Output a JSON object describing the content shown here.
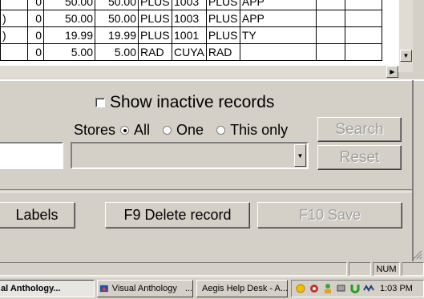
{
  "grid": {
    "rows": [
      [
        "",
        "0",
        "50.00",
        "50.00",
        "PLUS",
        "1003",
        "PLUS",
        "APP"
      ],
      [
        ")",
        "0",
        "50.00",
        "50.00",
        "PLUS",
        "1003",
        "PLUS",
        "APP"
      ],
      [
        ")",
        "0",
        "19.99",
        "19.99",
        "PLUS",
        "1001",
        "PLUS",
        "TY"
      ],
      [
        "",
        "0",
        "5.00",
        "5.00",
        "RAD",
        "CUYA",
        "RAD",
        ""
      ]
    ]
  },
  "filters": {
    "show_inactive_label": "Show inactive records",
    "stores_label": "Stores",
    "radio_all": "All",
    "radio_one": "One",
    "radio_this_only": "This only",
    "search_label": "Search",
    "reset_label": "Reset"
  },
  "actions": {
    "labels_label": "Labels",
    "delete_label": "F9 Delete record",
    "save_label": "F10 Save"
  },
  "statusbar": {
    "num": "NUM"
  },
  "taskbar": {
    "task1": "al Anthology...",
    "task2": "Visual Anthology",
    "task2_suffix": "...",
    "task3": "Aegis Help Desk - A...",
    "clock": "1:03 PM"
  },
  "colors": {
    "face": "#d4d0c8",
    "shadow": "#808080",
    "highlight": "#ffffff",
    "disabled_text": "#a0a0a0"
  }
}
